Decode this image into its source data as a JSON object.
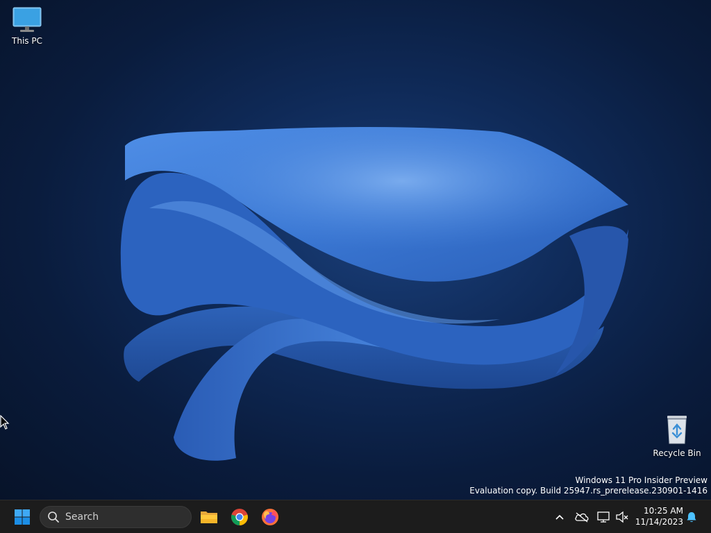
{
  "desktop": {
    "icons": [
      {
        "label": "This PC"
      },
      {
        "label": "Recycle Bin"
      }
    ],
    "watermark": {
      "line1": "Windows 11 Pro Insider Preview",
      "line2": "Evaluation copy. Build 25947.rs_prerelease.230901-1416"
    }
  },
  "taskbar": {
    "search": {
      "placeholder": "Search"
    },
    "pinned_apps": [
      "file-explorer-icon",
      "chrome-icon",
      "firefox-icon"
    ],
    "tray": {
      "icons": [
        "chevron-up-icon",
        "onedrive-icon",
        "network-icon",
        "volume-muted-icon",
        "bell-icon"
      ],
      "time": "10:25 AM",
      "date": "11/14/2023"
    }
  },
  "colors": {
    "accent": "#0078d4",
    "taskbar": "#1c1c1c",
    "wallpaper_dark": "#0a1c3d",
    "bloom": "#3a7ad6"
  }
}
